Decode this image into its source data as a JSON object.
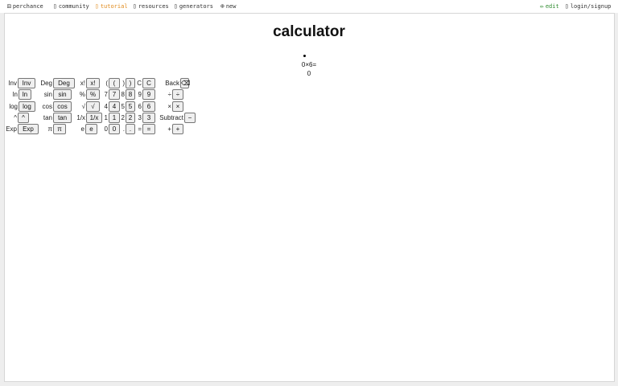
{
  "nav": {
    "logo_label": "perchance",
    "community": "community",
    "tutorial": "tutorial",
    "resources": "resources",
    "generators": "generators",
    "new": "new",
    "edit": "edit",
    "login": "login/signup"
  },
  "icons": {
    "logo": "dice-icon",
    "community": "chat-icon",
    "tutorial": "book-icon",
    "resources": "folder-icon",
    "generators": "list-icon",
    "new": "plus-circle-icon",
    "edit": "pencil-icon",
    "login": "user-icon"
  },
  "colors": {
    "active_tab": "#e08a1a",
    "edit": "#2e8b2e"
  },
  "calc": {
    "title": "calculator",
    "expression": "0×6=",
    "result": "0"
  },
  "rows": [
    [
      {
        "label": "Inv",
        "btn": "Inv"
      },
      {
        "label": "Deg",
        "btn": "Deg"
      },
      {
        "label": "x!",
        "btn": "x!"
      },
      {
        "label": "(",
        "btn": "("
      },
      {
        "label": ")",
        "btn": ")"
      },
      {
        "label": "C",
        "btn": "C"
      },
      {
        "label": "Back",
        "btn": "⌫"
      }
    ],
    [
      {
        "label": "ln",
        "btn": "ln"
      },
      {
        "label": "sin",
        "btn": "sin"
      },
      {
        "label": "%",
        "btn": "%"
      },
      {
        "label": "7",
        "btn": "7"
      },
      {
        "label": "8",
        "btn": "8"
      },
      {
        "label": "9",
        "btn": "9"
      },
      {
        "label": "÷",
        "btn": "÷"
      }
    ],
    [
      {
        "label": "log",
        "btn": "log"
      },
      {
        "label": "cos",
        "btn": "cos"
      },
      {
        "label": "√",
        "btn": "√"
      },
      {
        "label": "4",
        "btn": "4"
      },
      {
        "label": "5",
        "btn": "5"
      },
      {
        "label": "6",
        "btn": "6"
      },
      {
        "label": "×",
        "btn": "×"
      }
    ],
    [
      {
        "label": "^",
        "btn": "^"
      },
      {
        "label": "tan",
        "btn": "tan"
      },
      {
        "label": "1/x",
        "btn": "1/x"
      },
      {
        "label": "1",
        "btn": "1"
      },
      {
        "label": "2",
        "btn": "2"
      },
      {
        "label": "3",
        "btn": "3"
      },
      {
        "label": "Subtract",
        "btn": "−"
      }
    ],
    [
      {
        "label": "Exp",
        "btn": "Exp"
      },
      {
        "label": "π",
        "btn": "π"
      },
      {
        "label": "e",
        "btn": "e"
      },
      {
        "label": "0",
        "btn": "0"
      },
      {
        "label": ".",
        "btn": "."
      },
      {
        "label": "=",
        "btn": "="
      },
      {
        "label": "+",
        "btn": "+"
      }
    ]
  ]
}
